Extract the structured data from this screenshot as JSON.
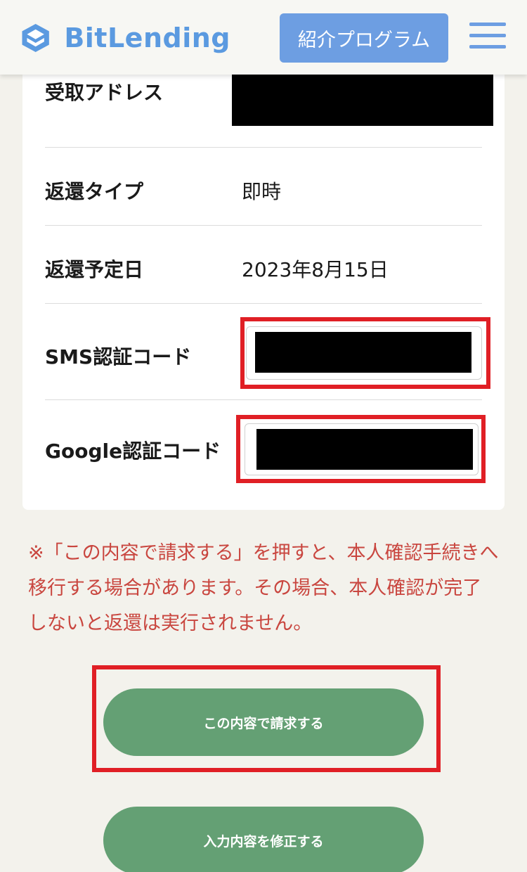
{
  "header": {
    "logo_text": "BitLending",
    "referral_label": "紹介プログラム"
  },
  "details": {
    "address_label": "受取アドレス",
    "type_label": "返還タイプ",
    "type_value": "即時",
    "date_label": "返還予定日",
    "date_value": "2023年8月15日",
    "sms_label": "SMS認証コード",
    "google_label": "Google認証コード"
  },
  "notice": "※「この内容で請求する」を押すと、本人確認手続きへ移行する場合があります。その場合、本人確認が完了しないと返還は実行されません。",
  "buttons": {
    "submit": "この内容で請求する",
    "edit": "入力内容を修正する"
  },
  "colors": {
    "brand_blue": "#5b9ae0",
    "button_green": "#64a074",
    "notice_red": "#c9463f",
    "highlight_red": "#e01f25"
  },
  "icons": {
    "logo": "bitlending-logo-icon",
    "menu": "hamburger-menu-icon"
  }
}
